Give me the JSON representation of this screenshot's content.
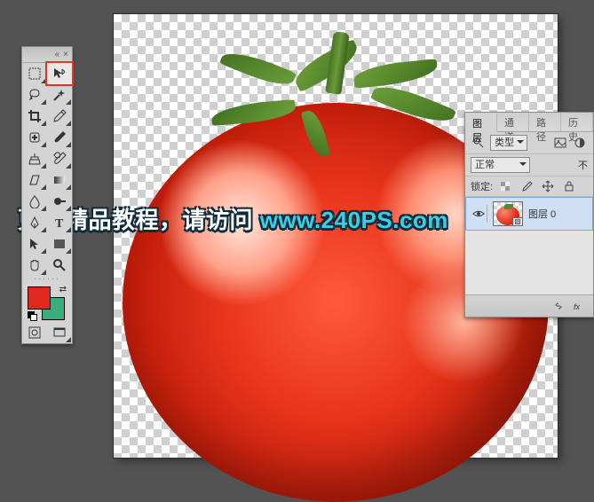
{
  "watermark": {
    "part1": "更多精品教程，请访问 ",
    "part2": "www.240PS.com"
  },
  "toolbox": {
    "header_collapse": "«",
    "header_close": "×",
    "tools": [
      {
        "id": "marquee",
        "name": "rectangular-marquee-tool"
      },
      {
        "id": "move",
        "name": "move-tool",
        "selected": true
      },
      {
        "id": "lasso",
        "name": "lasso-tool"
      },
      {
        "id": "magic-wand",
        "name": "magic-wand-tool"
      },
      {
        "id": "crop",
        "name": "crop-tool"
      },
      {
        "id": "eyedropper",
        "name": "eyedropper-tool"
      },
      {
        "id": "healing",
        "name": "spot-healing-brush-tool"
      },
      {
        "id": "brush",
        "name": "brush-tool"
      },
      {
        "id": "stamp",
        "name": "clone-stamp-tool"
      },
      {
        "id": "history-brush",
        "name": "history-brush-tool"
      },
      {
        "id": "eraser",
        "name": "eraser-tool"
      },
      {
        "id": "gradient",
        "name": "gradient-tool"
      },
      {
        "id": "blur",
        "name": "blur-tool"
      },
      {
        "id": "dodge",
        "name": "dodge-tool"
      },
      {
        "id": "pen",
        "name": "pen-tool"
      },
      {
        "id": "type",
        "name": "type-tool"
      },
      {
        "id": "path-select",
        "name": "path-selection-tool"
      },
      {
        "id": "shape",
        "name": "rectangle-shape-tool"
      },
      {
        "id": "hand",
        "name": "hand-tool"
      },
      {
        "id": "zoom",
        "name": "zoom-tool"
      }
    ],
    "swatch": {
      "foreground": "#e0281f",
      "background": "#3cae7d"
    }
  },
  "layers_panel": {
    "tabs": {
      "layers": "图层",
      "channels": "通道",
      "paths": "路径",
      "history_abbr": "历史"
    },
    "filter_label": "类型",
    "blend_mode": "正常",
    "opacity_label_abbr": "不",
    "lock_label": "锁定:",
    "layer0_name": "图层 0"
  }
}
